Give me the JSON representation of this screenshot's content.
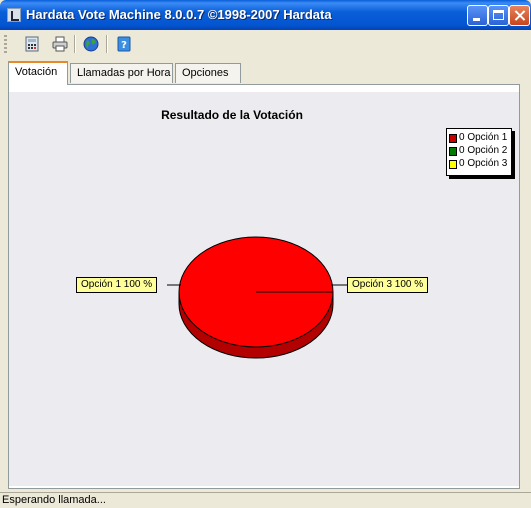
{
  "window": {
    "title": "Hardata Vote Machine 8.0.0.7 ©1998-2007 Hardata"
  },
  "toolbar": {
    "items": [
      {
        "icon": "calculator-icon"
      },
      {
        "icon": "printer-icon"
      },
      {
        "icon": "globe-icon"
      },
      {
        "icon": "help-icon"
      }
    ]
  },
  "tabs": [
    {
      "label": "Votación",
      "active": true
    },
    {
      "label": "Llamadas por Hora",
      "active": false
    },
    {
      "label": "Opciones",
      "active": false
    }
  ],
  "chart": {
    "title": "Resultado de la Votación",
    "legend": [
      {
        "label": "0 Opción 1",
        "color": "#c80000"
      },
      {
        "label": "0 Opción 2",
        "color": "#007a00"
      },
      {
        "label": "0 Opción 3",
        "color": "#ffff00"
      }
    ],
    "labels": {
      "left": "Opción 1 100 %",
      "right": "Opción 3 100 %"
    }
  },
  "chart_data": {
    "type": "pie",
    "title": "Resultado de la Votación",
    "categories": [
      "Opción 1",
      "Opción 2",
      "Opción 3"
    ],
    "values": [
      0,
      0,
      0
    ],
    "slice_labels": [
      "Opción 1 100 %",
      "Opción 3 100 %"
    ],
    "colors": [
      "#ff0000",
      "#008000",
      "#ffff00"
    ],
    "legend_position": "top-right"
  },
  "status": {
    "text": "Esperando llamada..."
  }
}
